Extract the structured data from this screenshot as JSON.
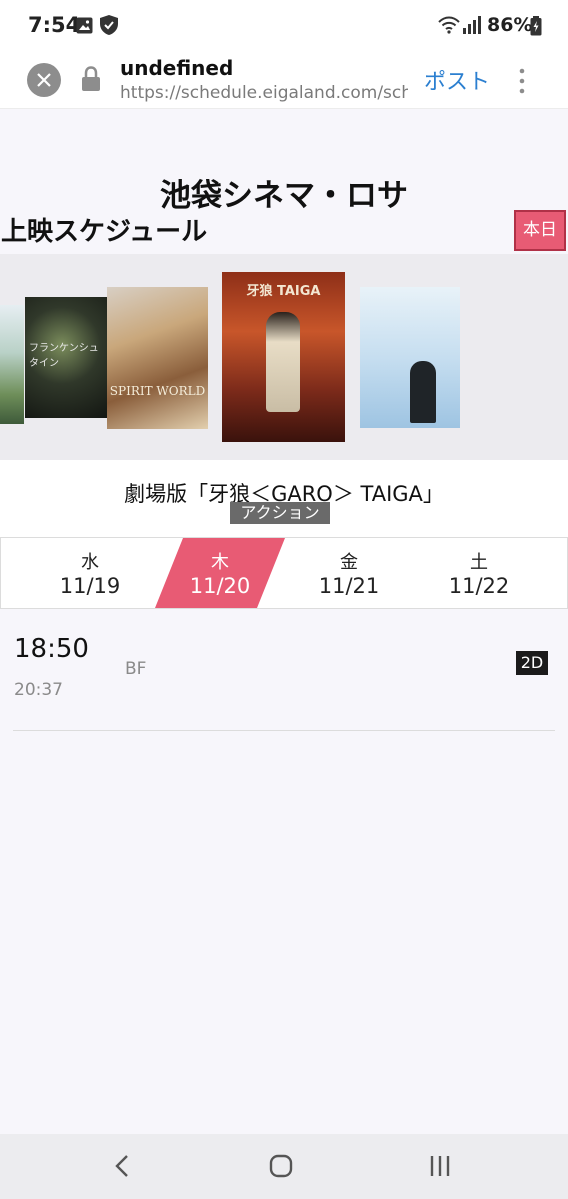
{
  "status_bar": {
    "time": "7:54",
    "battery": "86%",
    "icons": [
      "image-icon",
      "shield-icon",
      "wifi-icon",
      "signal-icon",
      "battery-icon"
    ]
  },
  "browser": {
    "title": "undefined",
    "url": "https://schedule.eigaland.com/schedule",
    "post_label": "ポスト",
    "close_icon": "close-icon",
    "lock_icon": "lock-icon",
    "menu_icon": "more-vert-icon"
  },
  "header": {
    "theater_name": "池袋シネマ・ロサ",
    "schedule_heading": "上映スケジュール",
    "today_label": "本日"
  },
  "posters": [
    {
      "text": ""
    },
    {
      "text": "フランケンシュタイン"
    },
    {
      "text": "SPIRIT WORLD"
    },
    {
      "text": "牙狼 TAIGA"
    },
    {
      "text": ""
    }
  ],
  "movie": {
    "title": "劇場版「牙狼＜GARO＞ TAIGA」",
    "genre": "アクション"
  },
  "dates": [
    {
      "dow": "水",
      "date": "11/19",
      "selected": false
    },
    {
      "dow": "木",
      "date": "11/20",
      "selected": true
    },
    {
      "dow": "金",
      "date": "11/21",
      "selected": false
    },
    {
      "dow": "土",
      "date": "11/22",
      "selected": false
    }
  ],
  "showtime": {
    "start": "18:50",
    "end": "20:37",
    "screen": "BF",
    "format": "2D"
  },
  "colors": {
    "accent": "#e85b74",
    "link": "#2b7fd0"
  },
  "nav": {
    "back_icon": "back-icon",
    "home_icon": "home-icon",
    "recents_icon": "recents-icon"
  }
}
